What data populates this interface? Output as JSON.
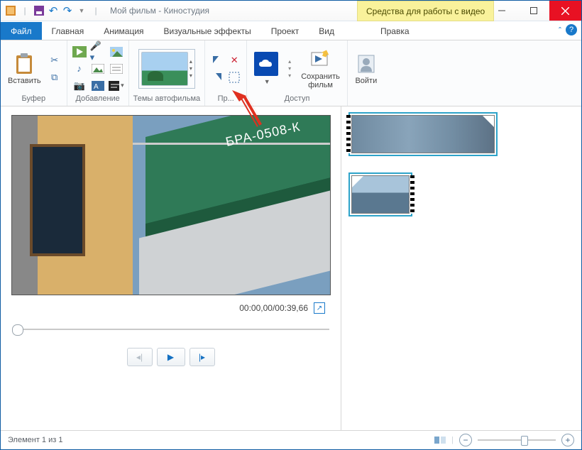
{
  "title": "Мой фильм - Киностудия",
  "contextual_tab_group": "Средства для работы с видео",
  "tabs": {
    "file": "Файл",
    "home": "Главная",
    "anim": "Анимация",
    "fx": "Визуальные эффекты",
    "project": "Проект",
    "view": "Вид",
    "edit": "Правка"
  },
  "ribbon": {
    "paste": "Вставить",
    "buffer_group": "Буфер",
    "add_group": "Добавление",
    "themes_group": "Темы автофильма",
    "edit_group": "Пр...",
    "save_movie": "Сохранить\nфильм",
    "access_group": "Доступ",
    "signin": "Войти"
  },
  "timecode": "00:00,00/00:39,66",
  "status": "Элемент 1 из 1"
}
